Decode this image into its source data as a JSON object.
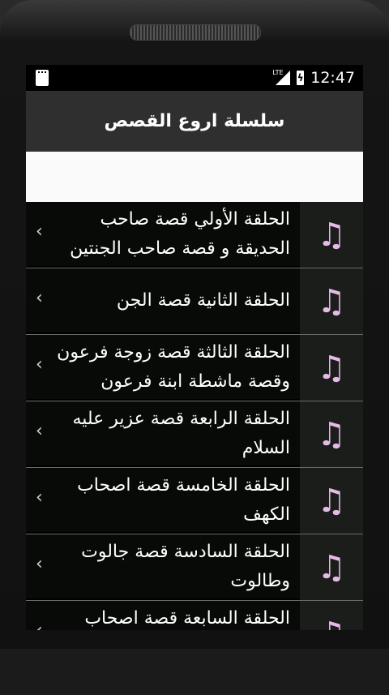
{
  "statusbar": {
    "network_label": "LTE",
    "time": "12:47"
  },
  "actionbar": {
    "title": "سلسلة اروع القصص"
  },
  "episodes": [
    {
      "label": "الحلقة الأولي قصة صاحب الحديقة و قصة صاحب الجنتين"
    },
    {
      "label": "الحلقة الثانية قصة الجن"
    },
    {
      "label": "الحلقة الثالثة قصة زوجة فرعون وقصة ماشطة ابنة فرعون"
    },
    {
      "label": "الحلقة الرابعة قصة عزير عليه السلام"
    },
    {
      "label": "الحلقة الخامسة قصة اصحاب الكهف"
    },
    {
      "label": "الحلقة السادسة قصة جالوت وطالوت"
    },
    {
      "label": "الحلقة السابعة قصة اصحاب"
    }
  ],
  "icons": {
    "row_icon": "music-note-icon",
    "chevron": "chevron-left-icon"
  },
  "colors": {
    "accent_icon": "#e6b9e6",
    "actionbar": "#2f2f2f"
  }
}
